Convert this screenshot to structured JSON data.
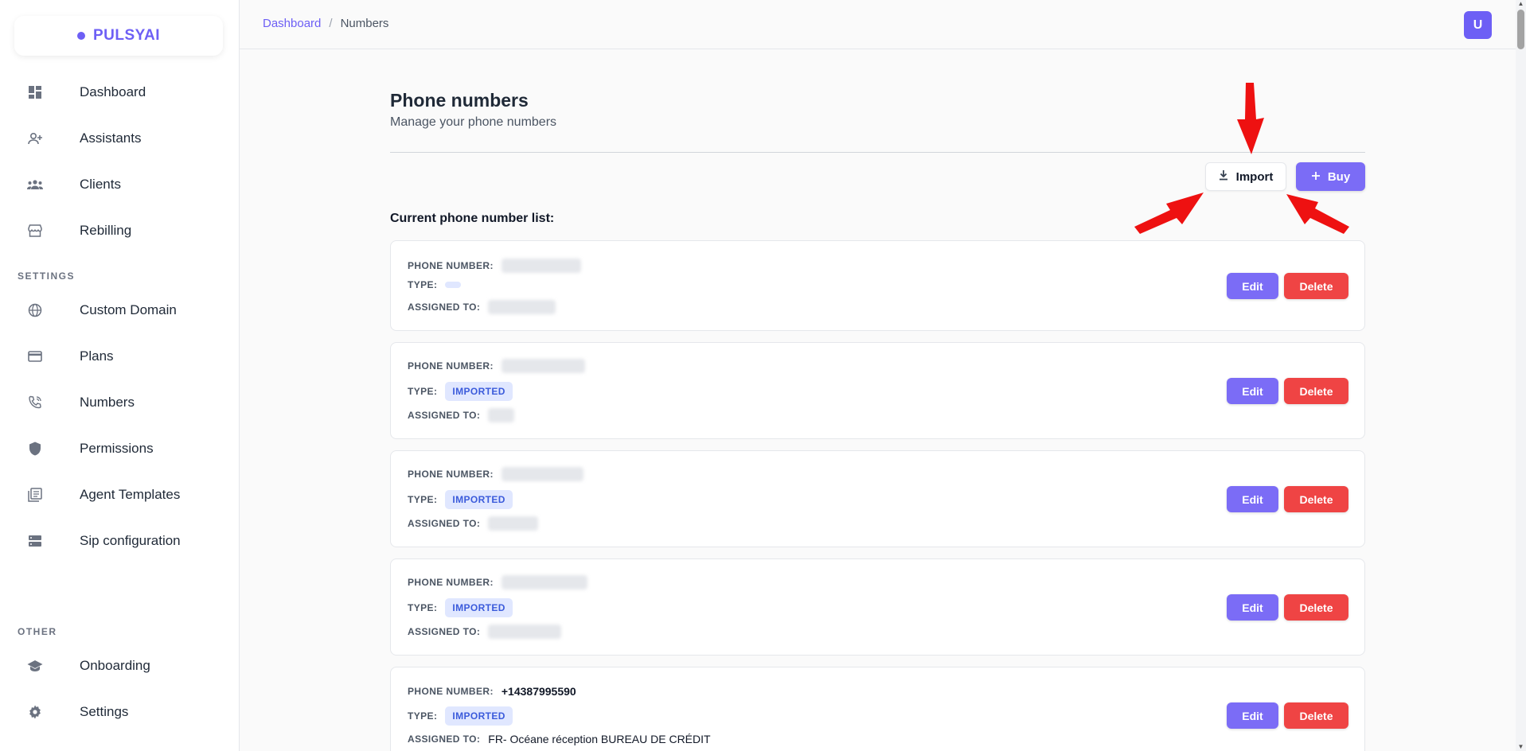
{
  "brand": {
    "name": "PULSYAI",
    "accent": "#6d5ff5",
    "danger": "#ef4444"
  },
  "sidebar": {
    "main_items": [
      {
        "label": "Dashboard",
        "icon": "dashboard-icon"
      },
      {
        "label": "Assistants",
        "icon": "person-add-icon"
      },
      {
        "label": "Clients",
        "icon": "groups-icon"
      },
      {
        "label": "Rebilling",
        "icon": "storefront-icon"
      }
    ],
    "settings_section": "SETTINGS",
    "settings_items": [
      {
        "label": "Custom Domain",
        "icon": "globe-icon"
      },
      {
        "label": "Plans",
        "icon": "credit-card-icon"
      },
      {
        "label": "Numbers",
        "icon": "phone-icon"
      },
      {
        "label": "Permissions",
        "icon": "shield-icon"
      },
      {
        "label": "Agent Templates",
        "icon": "library-icon"
      },
      {
        "label": "Sip configuration",
        "icon": "storage-icon"
      }
    ],
    "other_section": "OTHER",
    "other_items": [
      {
        "label": "Onboarding",
        "icon": "graduation-cap-icon"
      },
      {
        "label": "Settings",
        "icon": "gear-icon"
      }
    ]
  },
  "header": {
    "breadcrumb": {
      "parent": "Dashboard",
      "separator": "/",
      "current": "Numbers"
    },
    "avatar_initial": "U"
  },
  "main": {
    "title": "Phone numbers",
    "subtitle": "Manage your phone numbers",
    "import_label": "Import",
    "buy_label": "Buy",
    "list_heading": "Current phone number list:",
    "labels": {
      "phone_number": "PHONE NUMBER:",
      "type": "TYPE:",
      "assigned_to": "ASSIGNED TO:"
    },
    "edit_label": "Edit",
    "delete_label": "Delete",
    "cards": [
      {
        "phone_number": "",
        "type": "",
        "assigned_to": ""
      },
      {
        "phone_number": "",
        "type": "IMPORTED",
        "assigned_to": ""
      },
      {
        "phone_number": "",
        "type": "IMPORTED",
        "assigned_to": ""
      },
      {
        "phone_number": "",
        "type": "IMPORTED",
        "assigned_to": ""
      },
      {
        "phone_number": "+14387995590",
        "type": "IMPORTED",
        "assigned_to": "FR- Océane réception BUREAU DE CRÉDIT"
      }
    ]
  }
}
